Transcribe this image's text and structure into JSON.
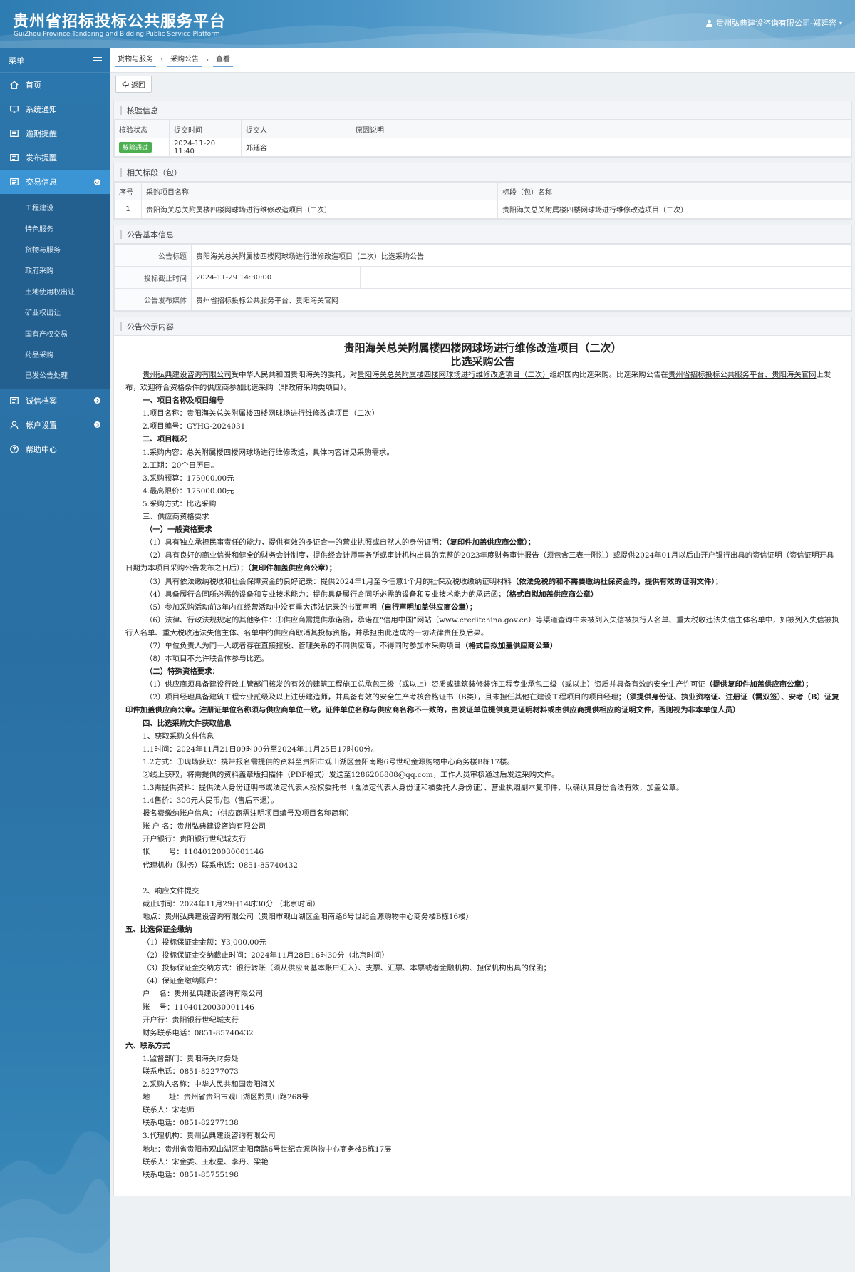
{
  "header": {
    "title_cn": "贵州省招标投标公共服务平台",
    "title_en": "GuiZhou Province Tendering and Bidding Public Service Platform",
    "user": "贵州弘典建设咨询有限公司-郑廷容"
  },
  "sidebar": {
    "menu_label": "菜单",
    "items": [
      {
        "label": "首页",
        "icon": "home-icon"
      },
      {
        "label": "系统通知",
        "icon": "monitor-icon"
      },
      {
        "label": "逾期提醒",
        "icon": "list-icon"
      },
      {
        "label": "发布提醒",
        "icon": "list-icon"
      },
      {
        "label": "交易信息",
        "icon": "list-icon"
      }
    ],
    "sub_items": [
      "工程建设",
      "特色服务",
      "货物与服务",
      "政府采购",
      "土地使用权出让",
      "矿业权出让",
      "国有产权交易",
      "药品采购",
      "已发公告处理"
    ],
    "bottom_items": [
      {
        "label": "诚信档案",
        "icon": "list-icon"
      },
      {
        "label": "帐户设置",
        "icon": "user-icon"
      },
      {
        "label": "帮助中心",
        "icon": "help-icon"
      }
    ]
  },
  "breadcrumb": [
    "货物与服务",
    "采购公告",
    "查看"
  ],
  "back_label": "返回",
  "verify": {
    "title": "核验信息",
    "headers": [
      "核验状态",
      "提交时间",
      "提交人",
      "原因说明"
    ],
    "status": "核验通过",
    "time": "2024-11-20 11:40",
    "person": "郑廷容",
    "reason": ""
  },
  "sections": {
    "title": "相关标段（包）",
    "headers": [
      "序号",
      "采购项目名称",
      "标段（包）名称"
    ],
    "row": {
      "no": "1",
      "project": "贵阳海关总关附属楼四楼网球场进行维修改造项目（二次）",
      "section": "贵阳海关总关附属楼四楼网球场进行维修改造项目（二次）"
    }
  },
  "basic": {
    "title": "公告基本信息",
    "title_label": "公告标题",
    "title_value": "贵阳海关总关附属楼四楼网球场进行维修改造项目（二次）比选采购公告",
    "deadline_label": "投标截止时间",
    "deadline_value": "2024-11-29 14:30:00",
    "media_label": "公告发布媒体",
    "media_value": "贵州省招标投标公共服务平台、贵阳海关官网"
  },
  "content": {
    "panel_title": "公告公示内容",
    "title1": "贵阳海关总关附属楼四楼网球场进行维修改造项目（二次）",
    "title2": "比选采购公告",
    "intro_a": "贵州弘典建设咨询有限公司",
    "intro_b": "受中华人民共和国贵阳海关的委托，对",
    "intro_c": "贵阳海关总关附属楼四楼网球场进行维修改造项目（二次）",
    "intro_d": "组织国内比选采购。比选采购公告在",
    "intro_e": "贵州省招标投标公共服务平台、贵阳海关官网",
    "intro_f": "上发布，欢迎符合资格条件的供应商参加比选采购（非政府采购类项目）。",
    "s1": "一、项目名称及项目编号",
    "s1_1": "1.项目名称：贵阳海关总关附属楼四楼网球场进行维修改造项目（二次）",
    "s1_2": "2.项目编号：GYHG-2024031",
    "s2": "二、项目概况",
    "s2_1": "1.采购内容：总关附属楼四楼网球场进行维修改造，具体内容详见采购需求。",
    "s2_2": "2.工期：20个日历日。",
    "s2_3": "3.采购预算：175000.00元",
    "s2_4": "4.最高限价：175000.00元",
    "s2_5": "5.采购方式：比选采购",
    "s3": "三、供应商资格要求",
    "s3a": "（一）一般资格要求",
    "s3a_1a": "（1）具有独立承担民事责任的能力，提供有效的多证合一的营业执照或自然人的身份证明：",
    "s3a_1b": "（复印件加盖供应商公章）；",
    "s3a_2a": "（2）具有良好的商业信誉和健全的财务会计制度，提供经会计师事务所或审计机构出具的完整的2023年度财务审计报告（须包含三表一附注）或提供2024年01月以后由开户银行出具的资信证明（资信证明开具日期为本项目采购公告发布之日后）；",
    "s3a_2b": "（复印件加盖供应商公章）；",
    "s3a_3a": "（3）具有依法缴纳税收和社会保障资金的良好记录：提供2024年1月至今任意1个月的社保及税收缴纳证明材料",
    "s3a_3b": "（依法免税的和不需要缴纳社保资金的，提供有效的证明文件）；",
    "s3a_4a": "（4）具备履行合同所必需的设备和专业技术能力：提供具备履行合同所必需的设备和专业技术能力的承诺函；",
    "s3a_4b": "（格式自拟加盖供应商公章）",
    "s3a_5a": "（5）参加采购活动前3年内在经营活动中没有重大违法记录的书面声明",
    "s3a_5b": "（自行声明加盖供应商公章）；",
    "s3a_6": "（6）法律、行政法规规定的其他条件：①供应商需提供承诺函，承诺在“信用中国”网站（www.creditchina.gov.cn）等渠道查询中未被列入失信被执行人名单、重大税收违法失信主体名单中，如被列入失信被执行人名单、重大税收违法失信主体、名单中的供应商取消其投标资格，并承担由此造成的一切法律责任及后果。",
    "s3a_7a": "（7）单位负责人为同一人或者存在直接控股、管理关系的不同供应商，不得同时参加本采购项目",
    "s3a_7b": "（格式自拟加盖供应商公章）",
    "s3a_8": "（8）本项目不允许联合体参与比选。",
    "s3b": "（二）特殊资格要求：",
    "s3b_1a": "（1）供应商须具备建设行政主管部门核发的有效的建筑工程施工总承包三级（或以上）资质或建筑装修装饰工程专业承包二级（或以上）资质并具备有效的安全生产许可证",
    "s3b_1b": "（提供复印件加盖供应商公章）；",
    "s3b_2a": "（2）项目经理具备建筑工程专业贰级及以上注册建造师，并具备有效的安全生产考核合格证书（B类），且未担任其他在建设工程项目的项目经理；",
    "s3b_2b": "（须提供身份证、执业资格证、注册证（需双签）、安考（B）证复印件加盖供应商公章。注册证单位名称须与供应商单位一致，证件单位名称与供应商名称不一致的，由发证单位提供变更证明材料或由供应商提供相应的证明文件，否则视为非本单位人员）",
    "s4": "四、比选采购文件获取信息",
    "s4_1": "1、获取采购文件信息",
    "s4_2": "1.1时间：2024年11月21日09时00分至2024年11月25日17时00分。",
    "s4_3": "1.2方式：①现场获取：携带报名需提供的资料至贵阳市观山湖区金阳南路6号世纪金源购物中心商务楼B栋17楼。",
    "s4_4": "②线上获取，将需提供的资料盖章版扫描件（PDF格式）发送至1286206808@qq.com，工作人员审核通过后发送采购文件。",
    "s4_5": "1.3需提供资料：提供法人身份证明书或法定代表人授权委托书（含法定代表人身份证和被委托人身份证）、营业执照副本复印件、以确认其身份合法有效，加盖公章。",
    "s4_6": "1.4售价：300元人民币/包（售后不退）。",
    "s4_7": "报名费缴纳账户信息：（供应商需注明项目编号及项目名称简称）",
    "s4_8": "账 户 名：贵州弘典建设咨询有限公司",
    "s4_9": "开户银行：贵阳银行世纪城支行",
    "s4_10": "帐        号：11040120030001146",
    "s4_11": "代理机构（财务）联系电话：0851-85740432",
    "s4_12": "2、响应文件提交",
    "s4_13": "截止时间：2024年11月29日14时30分 （北京时间）",
    "s4_14": "地点：贵州弘典建设咨询有限公司（贵阳市观山湖区金阳南路6号世纪金源购物中心商务楼B栋16楼）",
    "s5": "五、比选保证金缴纳",
    "s5_1": "（1）投标保证金金额：¥3,000.00元",
    "s5_2": "（2）投标保证金交纳截止时间：2024年11月28日16时30分（北京时间）",
    "s5_3": "（3）投标保证金交纳方式：银行转账（须从供应商基本账户汇入）、支票、汇票、本票或者金融机构、担保机构出具的保函；",
    "s5_4": "（4）保证金缴纳账户：",
    "s5_5": "户    名：贵州弘典建设咨询有限公司",
    "s5_6": "账    号：11040120030001146",
    "s5_7": "开户行：贵阳银行世纪城支行",
    "s5_8": "财务联系电话：0851-85740432",
    "s6": "六、联系方式",
    "s6_1": "1.监督部门：贵阳海关财务处",
    "s6_2": "联系电话：0851-82277073",
    "s6_3": "2.采购人名称：中华人民共和国贵阳海关",
    "s6_4": "地        址：贵州省贵阳市观山湖区黔灵山路268号",
    "s6_5": "联系人：宋老师",
    "s6_6": "联系电话：0851-82277138",
    "s6_7": "3.代理机构：贵州弘典建设咨询有限公司",
    "s6_8": "地址：贵州省贵阳市观山湖区金阳南路6号世纪金源购物中心商务楼B栋17层",
    "s6_9": "联系人：宋金委、王秋星、李丹、梁艳",
    "s6_10": "联系电话：0851-85755198"
  }
}
